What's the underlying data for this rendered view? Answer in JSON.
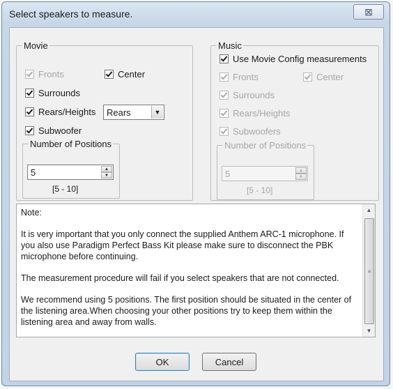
{
  "window": {
    "title": "Select speakers to measure.",
    "close_glyph": "⊠"
  },
  "movie": {
    "legend": "Movie",
    "fronts": {
      "label": "Fronts",
      "checked": true,
      "enabled": false
    },
    "center": {
      "label": "Center",
      "checked": true,
      "enabled": true
    },
    "surrounds": {
      "label": "Surrounds",
      "checked": true,
      "enabled": true
    },
    "rears_heights": {
      "label": "Rears/Heights",
      "checked": true,
      "enabled": true
    },
    "rears_select": {
      "value": "Rears"
    },
    "subwoofer": {
      "label": "Subwoofer",
      "checked": true,
      "enabled": true
    },
    "positions": {
      "legend": "Number of Positions",
      "value": "5",
      "range": "[5 - 10]"
    }
  },
  "music": {
    "legend": "Music",
    "use_movie": {
      "label": "Use Movie Config measurements",
      "checked": true,
      "enabled": true
    },
    "fronts": {
      "label": "Fronts",
      "checked": true,
      "enabled": false
    },
    "center": {
      "label": "Center",
      "checked": true,
      "enabled": false
    },
    "surrounds": {
      "label": "Surrounds",
      "checked": true,
      "enabled": false
    },
    "rears_heights": {
      "label": "Rears/Heights",
      "checked": true,
      "enabled": false
    },
    "subwoofers": {
      "label": "Subwoofers",
      "checked": true,
      "enabled": false
    },
    "positions": {
      "legend": "Number of Positions",
      "value": "5",
      "range": "[5 - 10]"
    }
  },
  "notes": {
    "heading": "Note:",
    "paragraphs": [
      "It is very important that you only connect the supplied Anthem ARC-1 microphone. If you also use Paradigm Perfect Bass Kit please make sure to disconnect the PBK microphone before continuing.",
      "The measurement procedure will fail if you select speakers that are not connected.",
      "We recommend using 5 positions. The first position should be situated in the center of the listening area.When choosing your other positions try to keep them within the listening area and away from walls."
    ]
  },
  "buttons": {
    "ok": "OK",
    "cancel": "Cancel"
  }
}
